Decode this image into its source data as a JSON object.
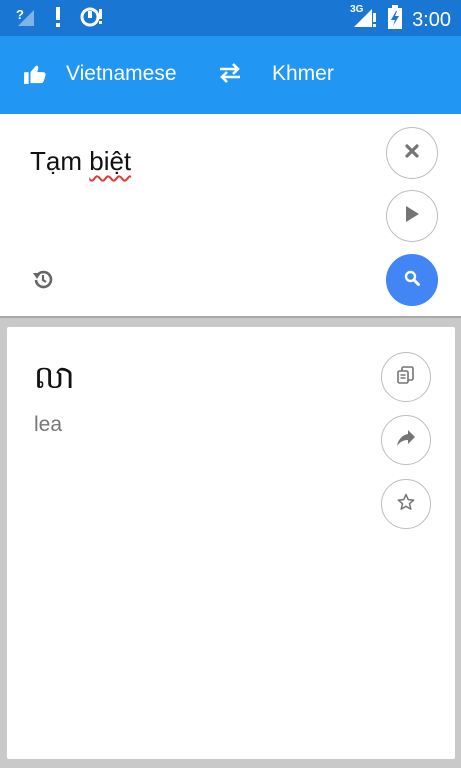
{
  "status_bar": {
    "time": "3:00",
    "network_label": "3G",
    "icons": [
      "signal-unknown-icon",
      "alert-icon",
      "sync-icon",
      "signal-icon",
      "battery-icon"
    ]
  },
  "app_bar": {
    "source_language": "Vietnamese",
    "target_language": "Khmer",
    "icons": [
      "thumb-up-icon",
      "swap-icon"
    ]
  },
  "input": {
    "text_prefix": "Tạm ",
    "text_misspelled": "biệt",
    "buttons": [
      "clear-icon",
      "play-icon",
      "search-icon",
      "history-icon"
    ]
  },
  "result": {
    "translation": "លា",
    "romanization": "lea",
    "buttons": [
      "copy-icon",
      "share-icon",
      "star-icon"
    ]
  },
  "colors": {
    "status_bar": "#1976d2",
    "app_bar": "#2196f3",
    "search_button": "#4285f4",
    "background": "#c9c9c9",
    "spell_underline": "#e53935"
  }
}
